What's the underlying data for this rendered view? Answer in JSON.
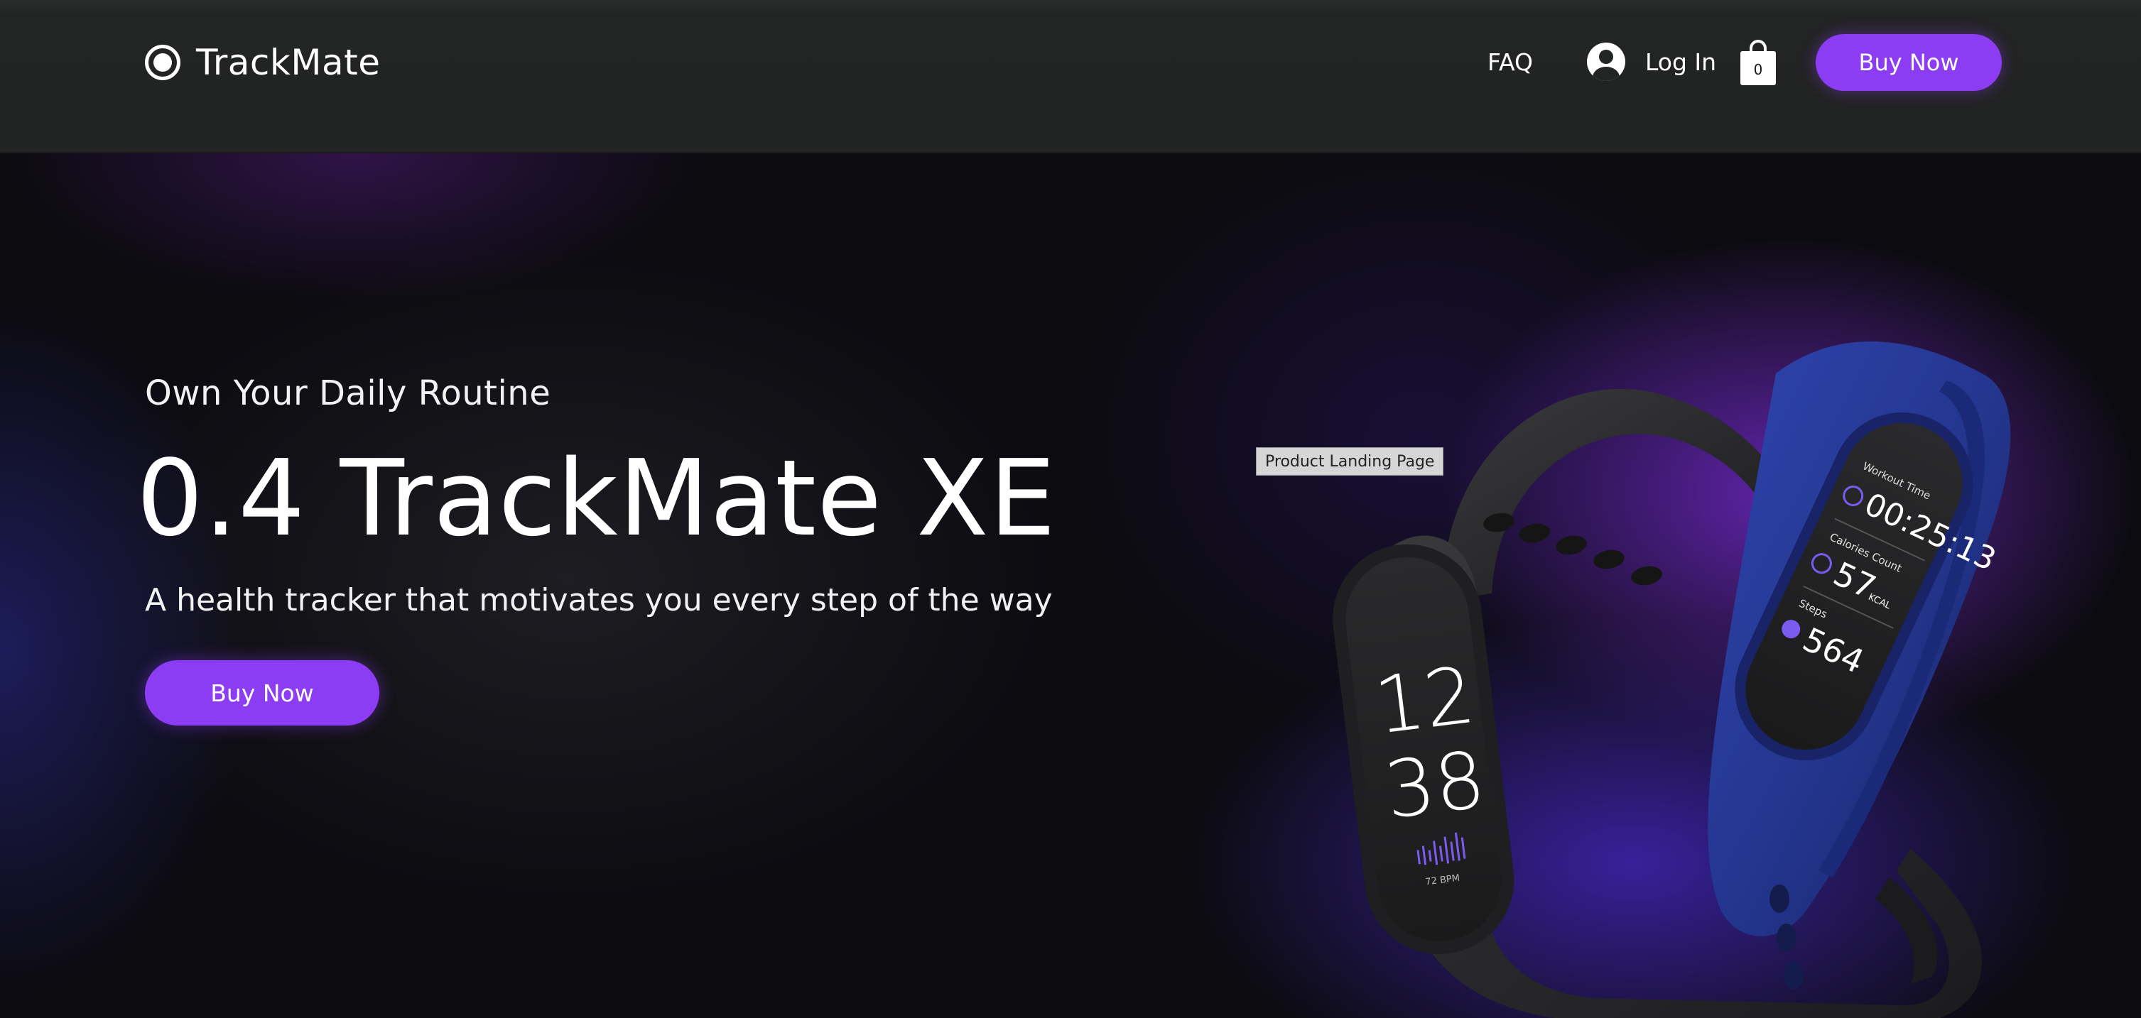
{
  "header": {
    "brand": "TrackMate",
    "nav": {
      "faq": "FAQ",
      "login": "Log In"
    },
    "cart_count": "0",
    "buy_label": "Buy Now"
  },
  "hero": {
    "eyebrow": "Own Your Daily Routine",
    "title": "0.4 TrackMate XE",
    "subtitle": "A health tracker that motivates you every step of the way",
    "buy_label": "Buy Now"
  },
  "tooltip": "Product Landing Page",
  "product_image": {
    "black_band_screen": {
      "hour": "12",
      "minute": "38",
      "bpm": "72 BPM"
    },
    "blue_band_screen": {
      "workout_label": "Workout Time",
      "workout_value": "00:25:13",
      "calories_label": "Calories Count",
      "calories_value": "57",
      "calories_unit": "KCAL",
      "steps_label": "Steps",
      "steps_value": "564"
    }
  },
  "colors": {
    "accent": "#8c3cf2",
    "header_bg": "#232424",
    "hero_bg": "#0c0b10",
    "band_blue": "#24368f",
    "band_black": "#2b2b2d"
  },
  "icons": [
    "logo-ring-icon",
    "user-avatar-icon",
    "shopping-bag-icon",
    "clock-icon",
    "bolt-icon",
    "footsteps-icon"
  ]
}
